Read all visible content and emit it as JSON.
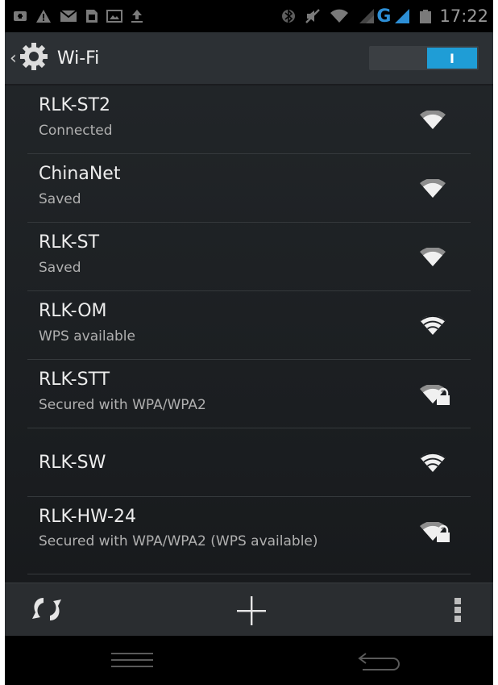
{
  "status_bar": {
    "time": "17:22",
    "network_type": "G",
    "icons": [
      "new-message-icon",
      "alert-icon",
      "email-icon",
      "sim-icon",
      "image-icon",
      "upload-icon",
      "bluetooth-icon",
      "mute-icon",
      "wifi-icon",
      "signal-icon",
      "battery-icon"
    ]
  },
  "action_bar": {
    "title": "Wi-Fi",
    "up_caret": "‹",
    "switch_label": "I",
    "switch_state": "on"
  },
  "networks": [
    {
      "ssid": "RLK-ST2",
      "status": "Connected",
      "secured": false,
      "signal_strength": 3
    },
    {
      "ssid": "ChinaNet",
      "status": "Saved",
      "secured": false,
      "signal_strength": 3
    },
    {
      "ssid": "RLK-ST",
      "status": "Saved",
      "secured": false,
      "signal_strength": 3
    },
    {
      "ssid": "RLK-OM",
      "status": "WPS available",
      "secured": false,
      "signal_strength": 4
    },
    {
      "ssid": "RLK-STT",
      "status": "Secured with WPA/WPA2",
      "secured": true,
      "signal_strength": 3
    },
    {
      "ssid": "RLK-SW",
      "status": "",
      "secured": false,
      "signal_strength": 4
    },
    {
      "ssid": "RLK-HW-24",
      "status": "Secured with WPA/WPA2 (WPS available)",
      "secured": true,
      "signal_strength": 3
    }
  ],
  "bottom_bar": {
    "icons": [
      "wps-icon",
      "add-icon",
      "overflow-menu-icon"
    ]
  },
  "nav_bar": {
    "icons": [
      "menu-icon",
      "back-icon"
    ]
  },
  "colors": {
    "accent": "#1f9dd6",
    "background": "#1d2023",
    "action_bar": "#2c3034"
  }
}
